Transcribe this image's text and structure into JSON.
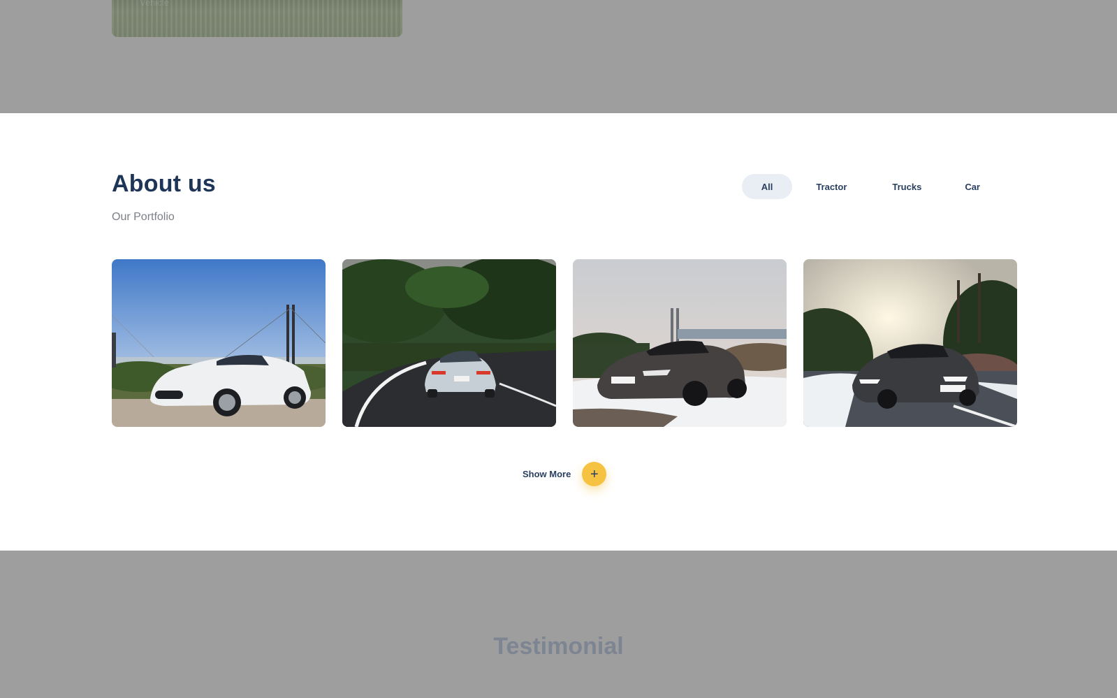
{
  "top_card": {
    "caption": "Vehicle"
  },
  "about": {
    "title": "About us",
    "subtitle": "Our Portfolio"
  },
  "filters": [
    {
      "label": "All",
      "active": true
    },
    {
      "label": "Tractor",
      "active": false
    },
    {
      "label": "Trucks",
      "active": false
    },
    {
      "label": "Car",
      "active": false
    }
  ],
  "gallery": [
    {
      "subject": "white-coupe-bridge"
    },
    {
      "subject": "silver-sedan-forest-road"
    },
    {
      "subject": "dark-sports-car-snow"
    },
    {
      "subject": "dark-sports-car-road-sunset"
    }
  ],
  "show_more": {
    "label": "Show More",
    "icon": "plus-icon"
  },
  "next_section": {
    "title": "Testimonial"
  },
  "colors": {
    "primary": "#1e3557",
    "accent": "#f5c242",
    "overlay": "#9e9e9e",
    "chip_active": "#e9eef5"
  }
}
